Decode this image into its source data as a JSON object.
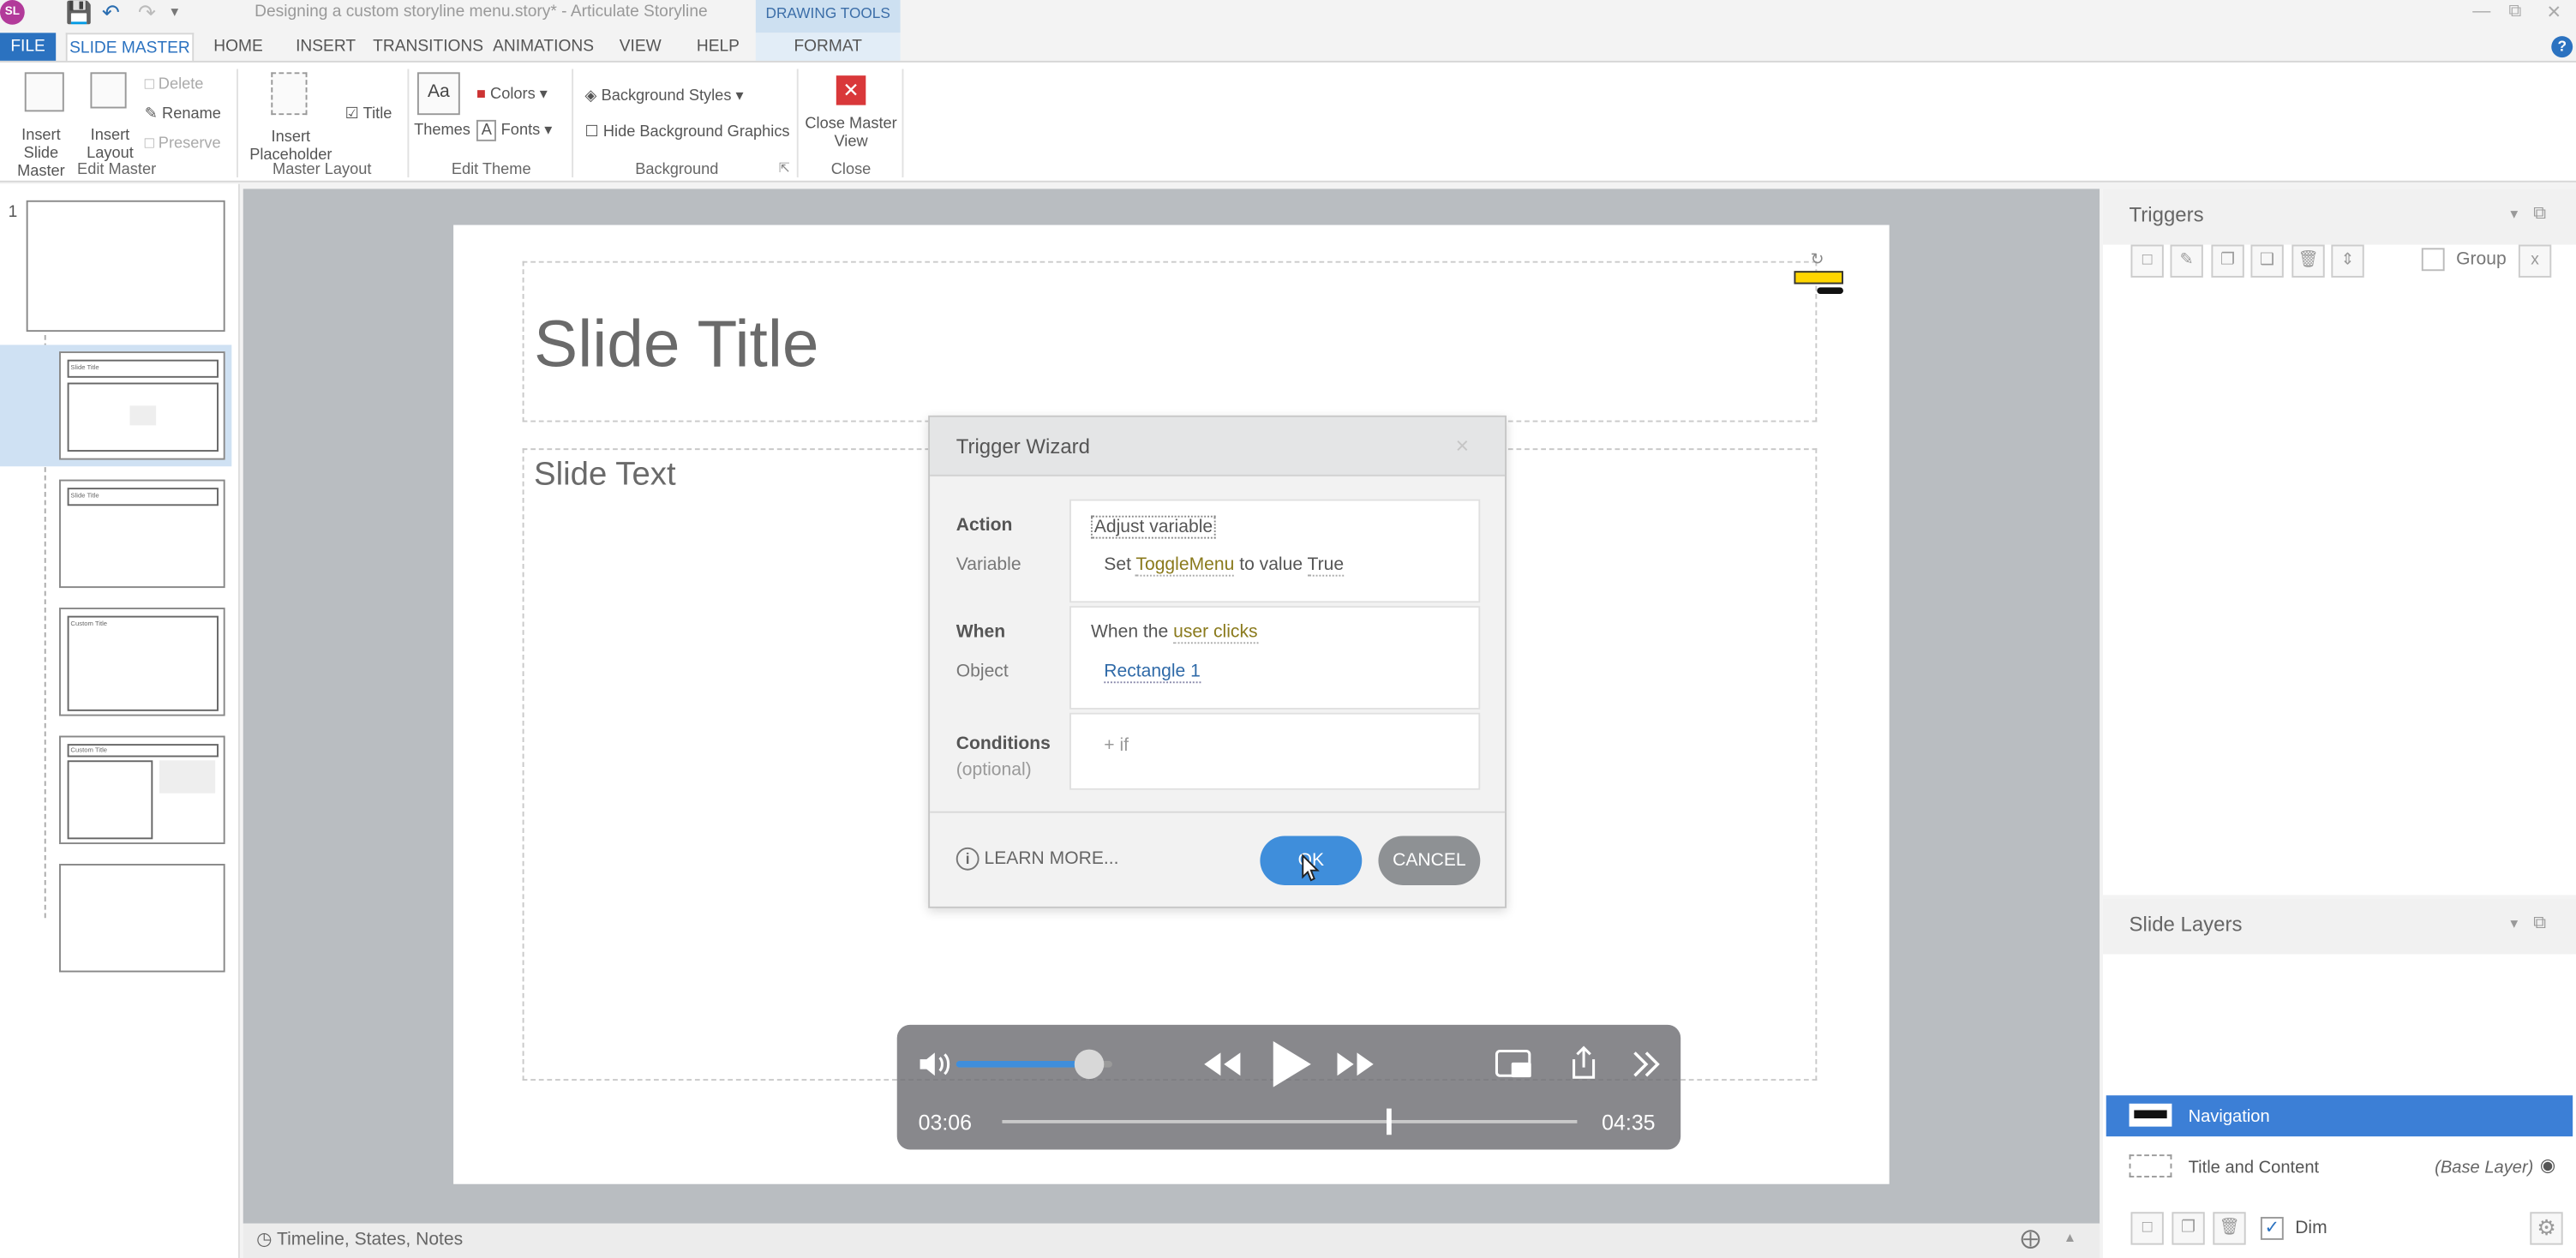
{
  "app": {
    "logo": "SL",
    "window_title": "Designing a custom storyline menu.story* - Articulate Storyline",
    "context_tab_header": "DRAWING TOOLS"
  },
  "tabs": [
    "FILE",
    "SLIDE MASTER",
    "HOME",
    "INSERT",
    "TRANSITIONS",
    "ANIMATIONS",
    "VIEW",
    "HELP",
    "FORMAT"
  ],
  "ribbon": {
    "insert_slide_master": "Insert Slide Master",
    "insert_layout": "Insert Layout",
    "delete": "Delete",
    "rename": "Rename",
    "preserve": "Preserve",
    "group_edit_master": "Edit Master",
    "insert_placeholder": "Insert Placeholder",
    "title_check": "Title",
    "group_master_layout": "Master Layout",
    "themes": "Themes",
    "colors": "Colors",
    "fonts": "Fonts",
    "group_edit_theme": "Edit Theme",
    "background_styles": "Background Styles",
    "hide_background_graphics": "Hide Background Graphics",
    "group_background": "Background",
    "close_master_view": "Close Master View",
    "group_close": "Close"
  },
  "left_panel": {
    "master_number": "1",
    "thumb_title": "Slide Title",
    "thumb_custom_title": "Custom Title"
  },
  "slide": {
    "title": "Slide Title",
    "text": "Slide Text"
  },
  "dialog": {
    "title": "Trigger Wizard",
    "close": "×",
    "action_label": "Action",
    "action_value": "Adjust variable",
    "variable_label": "Variable",
    "variable_set": "Set",
    "variable_name": "ToggleMenu",
    "variable_to": "to value",
    "variable_value": "True",
    "when_label": "When",
    "when_prefix": "When the",
    "when_value": "user clicks",
    "object_label": "Object",
    "object_value": "Rectangle 1",
    "conditions_label": "Conditions",
    "conditions_optional": "(optional)",
    "conditions_add": "+ if",
    "learn_more": "LEARN MORE...",
    "ok": "OK",
    "cancel": "CANCEL"
  },
  "player": {
    "current_time": "03:06",
    "total_time": "04:35",
    "progress": 0.67,
    "volume": 0.85
  },
  "triggers_panel": {
    "title": "Triggers",
    "group": "Group"
  },
  "layers_panel": {
    "title": "Slide Layers",
    "layer_navigation": "Navigation",
    "layer_base": "Title and Content",
    "base_layer_tag": "(Base Layer)",
    "dim": "Dim"
  },
  "status_bar": {
    "label": "Timeline, States, Notes"
  },
  "colors": {
    "accent": "#2b72c0",
    "ok_button": "#3f8edb",
    "cancel_button": "#8e9194",
    "layer_selected": "#3c7fd6"
  }
}
